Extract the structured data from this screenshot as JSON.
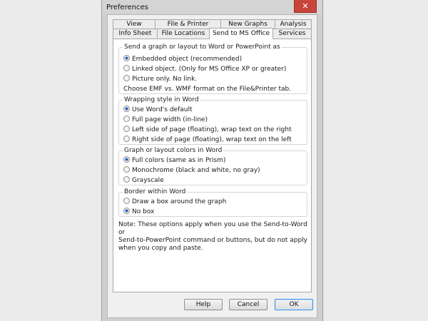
{
  "window": {
    "title": "Preferences",
    "close_glyph": "✕"
  },
  "tabs_row1": [
    "View",
    "File & Printer",
    "New Graphs",
    "Analysis"
  ],
  "tabs_row2": [
    "Info Sheet",
    "File Locations",
    "Send to MS Office",
    "Services"
  ],
  "active_tab": "Send to MS Office",
  "groups": {
    "send": {
      "title": "Send a graph or layout to Word or PowerPoint as",
      "options": [
        "Embedded object (recommended)",
        "Linked object. (Only for MS Office XP or greater)",
        "Picture only. No link."
      ],
      "selected": 0,
      "hint": "Choose EMF vs. WMF format on the File&Printer tab."
    },
    "wrap": {
      "title": "Wrapping style in Word",
      "options": [
        "Use Word's default",
        "Full page width (in-line)",
        "Left side of page (floating), wrap text on the right",
        "Right side of page (floating), wrap text on the left"
      ],
      "selected": 0
    },
    "colors": {
      "title": "Graph or layout colors in Word",
      "options": [
        "Full colors (same as in Prism)",
        "Monochrome (black and white, no gray)",
        "Grayscale"
      ],
      "selected": 0
    },
    "border": {
      "title": "Border within Word",
      "options": [
        "Draw a box around the graph",
        "No box"
      ],
      "selected": 1
    }
  },
  "note": "Note: These options apply when you use  the Send-to-Word or\nSend-to-PowerPoint command or buttons, but do not apply\nwhen you copy and paste.",
  "buttons": {
    "help": "Help",
    "cancel": "Cancel",
    "ok": "OK"
  },
  "colors": {
    "close_red": "#c7453b",
    "radio_selected": "#2161c4",
    "default_button_border": "#3a8ee6"
  }
}
